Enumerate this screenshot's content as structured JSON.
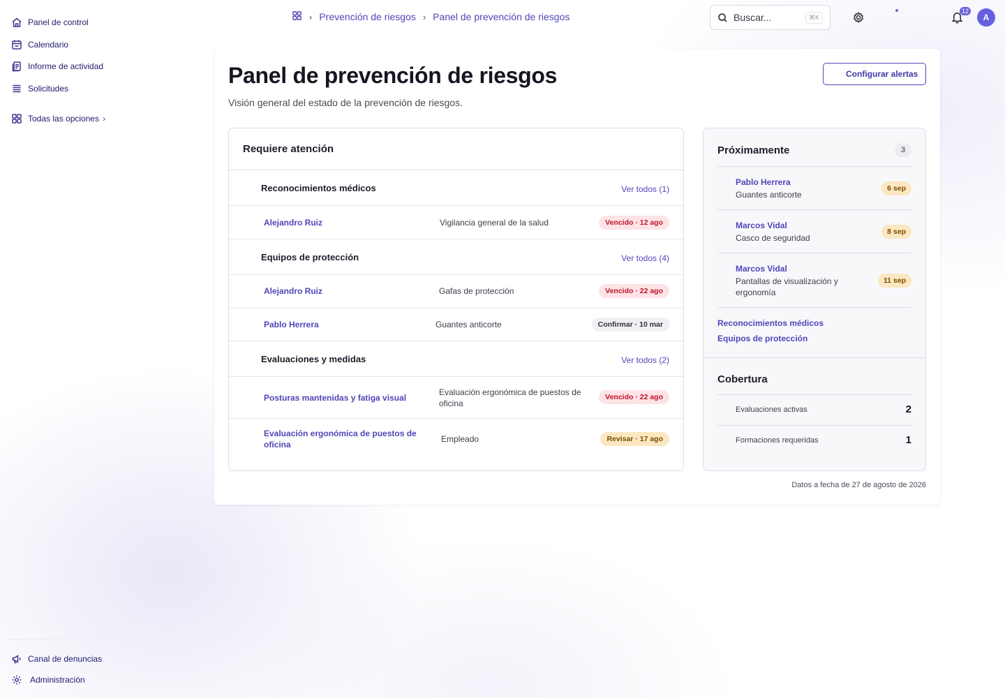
{
  "sidebar": {
    "items": [
      {
        "label": "Panel de control",
        "icon": "home-icon"
      },
      {
        "label": "Calendario",
        "icon": "calendar-icon"
      },
      {
        "label": "Informe de actividad",
        "icon": "report-icon"
      },
      {
        "label": "Solicitudes",
        "icon": "list-icon"
      }
    ],
    "all_options": "Todas las opciones",
    "bottom": [
      {
        "label": "Canal de denuncias",
        "icon": "megaphone-icon"
      },
      {
        "label": "Administración",
        "icon": "gear-icon"
      }
    ]
  },
  "header": {
    "breadcrumb": [
      "Prevención de riesgos",
      "Panel de prevención de riesgos"
    ],
    "search_placeholder": "Buscar...",
    "search_shortcut": "⌘K",
    "notifications_count": "12",
    "avatar_initial": "A"
  },
  "page": {
    "title": "Panel de prevención de riesgos",
    "subtitle": "Visión general del estado de la prevención de riesgos.",
    "alerts_button": "Configurar alertas",
    "footer_date": "Datos a fecha de 27 de agosto de 2026"
  },
  "attention": {
    "title": "Requiere atención",
    "sections": [
      {
        "title": "Reconocimientos médicos",
        "link": "Ver todos (1)",
        "rows": [
          {
            "name": "Alejandro Ruiz",
            "desc": "Vigilancia general de la salud",
            "status": "Vencido · 12 ago",
            "tone": "red"
          }
        ]
      },
      {
        "title": "Equipos de protección",
        "link": "Ver todos (4)",
        "rows": [
          {
            "name": "Alejandro Ruiz",
            "desc": "Gafas de protección",
            "status": "Vencido · 22 ago",
            "tone": "red"
          },
          {
            "name": "Pablo Herrera",
            "desc": "Guantes anticorte",
            "status": "Confirmar · 10 mar",
            "tone": "gray"
          }
        ]
      },
      {
        "title": "Evaluaciones y medidas",
        "link": "Ver todos (2)",
        "rows": [
          {
            "name": "Posturas mantenidas y fatiga visual",
            "desc": "Evaluación ergonómica de puestos de oficina",
            "status": "Vencido · 22 ago",
            "tone": "red"
          },
          {
            "name": "Evaluación ergonómica de puestos de oficina",
            "desc": "Empleado",
            "status": "Revisar · 17 ago",
            "tone": "amber"
          }
        ]
      }
    ]
  },
  "upcoming": {
    "title": "Próximamente",
    "count": "3",
    "items": [
      {
        "name": "Pablo Herrera",
        "desc": "Guantes anticorte",
        "date": "6 sep"
      },
      {
        "name": "Marcos Vidal",
        "desc": "Casco de seguridad",
        "date": "8 sep"
      },
      {
        "name": "Marcos Vidal",
        "desc": "Pantallas de visualización y ergonomía",
        "date": "11 sep"
      }
    ],
    "links": [
      "Reconocimientos médicos",
      "Equipos de protección"
    ]
  },
  "coverage": {
    "title": "Cobertura",
    "items": [
      {
        "label": "Evaluaciones activas",
        "value": "2"
      },
      {
        "label": "Formaciones requeridas",
        "value": "1"
      }
    ]
  },
  "colors": {
    "accent": "#4f46b8",
    "danger": "#c01530",
    "warning": "#7a4d00",
    "avatar": "#6660e0"
  }
}
